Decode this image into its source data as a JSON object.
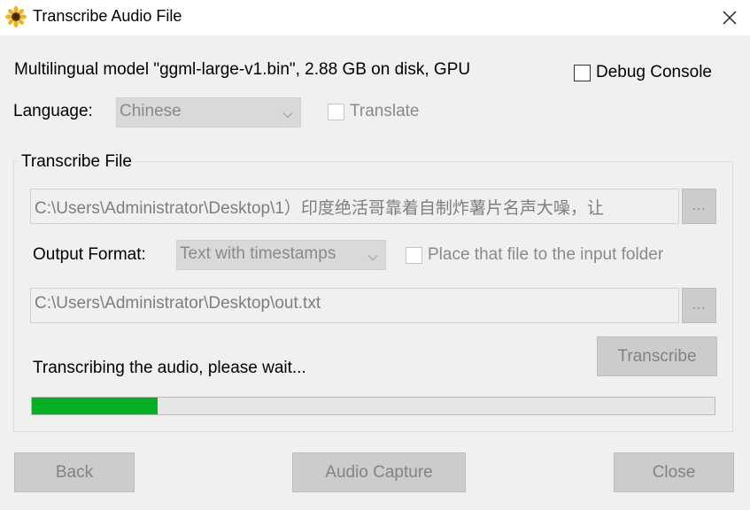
{
  "window": {
    "title": "Transcribe Audio File",
    "icon": "sunflower-icon"
  },
  "model_info": "Multilingual model \"ggml-large-v1.bin\", 2.88 GB on disk, GPU",
  "debug_console": {
    "label": "Debug Console",
    "checked": false
  },
  "language": {
    "label": "Language:",
    "selected": "Chinese",
    "translate_label": "Translate",
    "translate_checked": false
  },
  "transcribe_file": {
    "group_label": "Transcribe File",
    "input_path": "C:\\Users\\Administrator\\Desktop\\1）印度绝活哥靠着自制炸薯片名声大噪，让",
    "browse_input_label": "...",
    "output_format_label": "Output Format:",
    "output_format_selected": "Text with timestamps",
    "place_in_input_folder_label": "Place that file to the input folder",
    "place_in_input_folder_checked": false,
    "output_path": "C:\\Users\\Administrator\\Desktop\\out.txt",
    "browse_output_label": "...",
    "transcribe_button": "Transcribe",
    "status": "Transcribing the audio, please wait...",
    "progress_fraction": 0.184
  },
  "footer": {
    "back": "Back",
    "audio_capture": "Audio Capture",
    "close": "Close"
  },
  "colors": {
    "progress": "#06b025",
    "window_bg": "#f0f0f0",
    "disabled_button": "#cccccc"
  }
}
